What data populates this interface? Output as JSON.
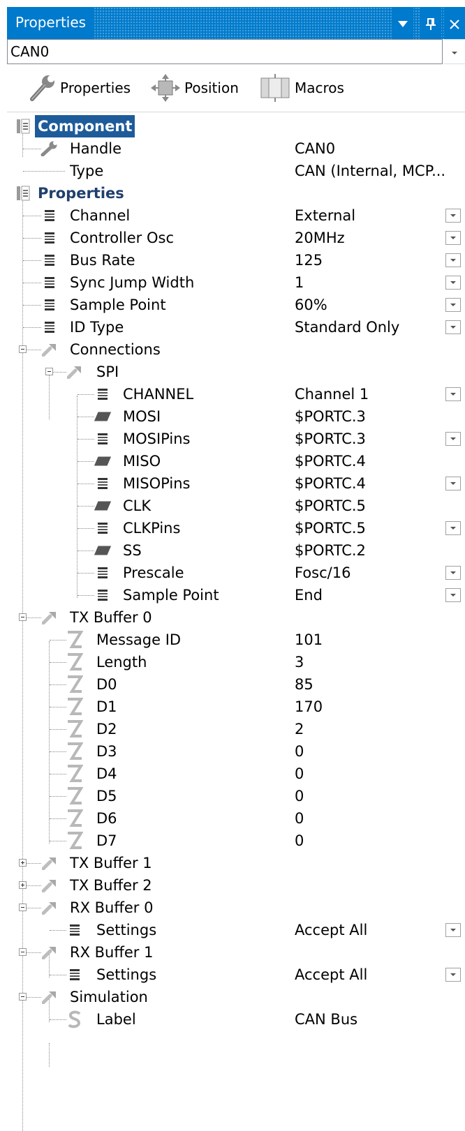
{
  "window": {
    "title": "Properties",
    "icons": {
      "dropdown": "triangle-down",
      "pin": "pin",
      "close": "close"
    }
  },
  "object_selector": {
    "value": "CAN0"
  },
  "toolbar": {
    "properties_label": "Properties",
    "position_label": "Position",
    "macros_label": "Macros"
  },
  "tree": {
    "rows": [
      {
        "label": "Component",
        "kind": "category",
        "selected": true
      },
      {
        "label": "Handle",
        "value": "CAN0",
        "icon": "wrench-icon"
      },
      {
        "label": "Type",
        "value": "CAN (Internal, MCP...",
        "icon": "none"
      },
      {
        "label": "Properties",
        "kind": "category"
      },
      {
        "label": "Channel",
        "value": "External",
        "icon": "list-icon",
        "dropdown": true
      },
      {
        "label": "Controller Osc",
        "value": "20MHz",
        "icon": "list-icon",
        "dropdown": true
      },
      {
        "label": "Bus Rate",
        "value": "125",
        "icon": "list-icon",
        "dropdown": true
      },
      {
        "label": "Sync Jump Width",
        "value": "1",
        "icon": "list-icon",
        "dropdown": true
      },
      {
        "label": "Sample Point",
        "value": "60%",
        "icon": "list-icon",
        "dropdown": true
      },
      {
        "label": "ID Type",
        "value": "Standard Only",
        "icon": "list-icon",
        "dropdown": true
      },
      {
        "label": "Connections",
        "icon": "tool-icon",
        "expander": "minus"
      },
      {
        "label": "SPI",
        "icon": "tool-icon",
        "expander": "minus"
      },
      {
        "label": "CHANNEL",
        "value": "Channel 1",
        "icon": "list-icon",
        "dropdown": true
      },
      {
        "label": "MOSI",
        "value": "$PORTC.3",
        "icon": "pin-icon"
      },
      {
        "label": "MOSIPins",
        "value": "$PORTC.3",
        "icon": "list-icon",
        "dropdown": true
      },
      {
        "label": "MISO",
        "value": "$PORTC.4",
        "icon": "pin-icon"
      },
      {
        "label": "MISOPins",
        "value": "$PORTC.4",
        "icon": "list-icon",
        "dropdown": true
      },
      {
        "label": "CLK",
        "value": "$PORTC.5",
        "icon": "pin-icon"
      },
      {
        "label": "CLKPins",
        "value": "$PORTC.5",
        "icon": "list-icon",
        "dropdown": true
      },
      {
        "label": "SS",
        "value": "$PORTC.2",
        "icon": "pin-icon"
      },
      {
        "label": "Prescale",
        "value": "Fosc/16",
        "icon": "list-icon",
        "dropdown": true
      },
      {
        "label": "Sample Point",
        "value": "End",
        "icon": "list-icon",
        "dropdown": true
      },
      {
        "label": "TX Buffer 0",
        "icon": "tool-icon",
        "expander": "minus"
      },
      {
        "label": "Message ID",
        "value": "101",
        "icon": "integer-icon"
      },
      {
        "label": "Length",
        "value": "3",
        "icon": "integer-icon"
      },
      {
        "label": "D0",
        "value": "85",
        "icon": "integer-icon"
      },
      {
        "label": "D1",
        "value": "170",
        "icon": "integer-icon"
      },
      {
        "label": "D2",
        "value": "2",
        "icon": "integer-icon"
      },
      {
        "label": "D3",
        "value": "0",
        "icon": "integer-icon"
      },
      {
        "label": "D4",
        "value": "0",
        "icon": "integer-icon"
      },
      {
        "label": "D5",
        "value": "0",
        "icon": "integer-icon"
      },
      {
        "label": "D6",
        "value": "0",
        "icon": "integer-icon"
      },
      {
        "label": "D7",
        "value": "0",
        "icon": "integer-icon"
      },
      {
        "label": "TX Buffer 1",
        "icon": "tool-icon",
        "expander": "plus"
      },
      {
        "label": "TX Buffer 2",
        "icon": "tool-icon",
        "expander": "plus"
      },
      {
        "label": "RX Buffer 0",
        "icon": "tool-icon",
        "expander": "minus"
      },
      {
        "label": "Settings",
        "value": "Accept All",
        "icon": "list-icon",
        "dropdown": true
      },
      {
        "label": "RX Buffer 1",
        "icon": "tool-icon",
        "expander": "minus"
      },
      {
        "label": "Settings",
        "value": "Accept All",
        "icon": "list-icon",
        "dropdown": true
      },
      {
        "label": "Simulation",
        "icon": "tool-icon",
        "expander": "minus"
      },
      {
        "label": "Label",
        "value": "CAN Bus",
        "icon": "string-icon"
      }
    ]
  }
}
